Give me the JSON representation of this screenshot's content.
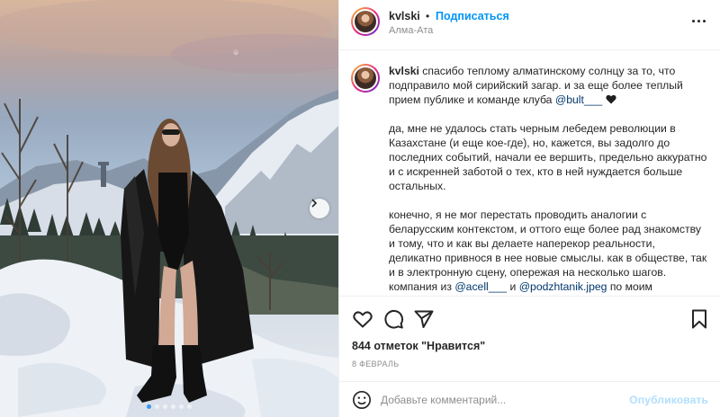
{
  "post": {
    "username": "kvlski",
    "separator": "•",
    "follow_label": "Подписаться",
    "location": "Алма-Ата",
    "caption": {
      "username": "kvlski",
      "p1_before": " спасибо теплому алматинскому солнцу за то, что подправило мой сирийский загар. и за еще более теплый прием публике и команде клуба ",
      "p1_mention": "@bult___",
      "p2": "да, мне не удалось стать черным лебедем революции в Казахстане (и еще кое-где), но, кажется, вы задолго до последних событий, начали ее вершить, предельно аккуратно и с искренней заботой о тех, кто в ней нуждается больше остальных.",
      "p3_before": "конечно, я не мог перестать проводить аналогии с беларусским контекстом, и оттого еще более рад знакомству и тому, что и как вы делаете наперекор реальности, деликатно привнося в нее новые смыслы. как в обществе, так и в электронную сцену, опережая на несколько шагов. компания из ",
      "p3_mention1": "@acell___",
      "p3_and": " и ",
      "p3_mention2": "@podzhtanik.jpeg",
      "p3_after": " по моим ощущениям, была одной из самых гармоничных, в которых мне доводилось играть, и даже просто"
    },
    "likes_text": "844 отметок \"Нравится\"",
    "date": "8 февраль",
    "comment_placeholder": "Добавьте комментарий...",
    "publish_label": "Опубликовать",
    "carousel": {
      "slides": 6,
      "active_index": 0
    }
  },
  "icons": {
    "like": "heart-outline-icon",
    "comment": "comment-bubble-icon",
    "share": "paper-plane-icon",
    "save": "bookmark-icon",
    "more": "more-dots-icon",
    "emoji": "smiley-icon",
    "next": "chevron-right-icon",
    "caption_emoji": "black-heart-icon"
  },
  "colors": {
    "accent": "#0095f6",
    "mention": "#00376b",
    "muted": "#8e8e8e",
    "publish_disabled": "#b2dffc"
  }
}
